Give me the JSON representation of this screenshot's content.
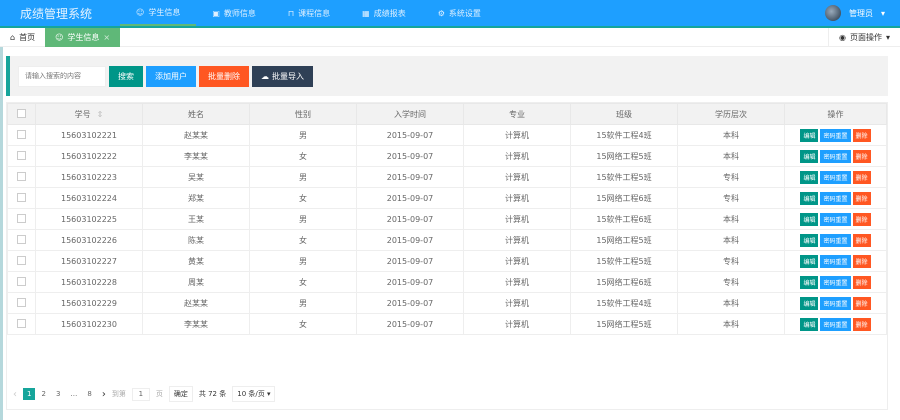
{
  "app": {
    "title": "成绩管理系统"
  },
  "nav": [
    {
      "icon": "users-icon",
      "label": "学生信息"
    },
    {
      "icon": "id-card-icon",
      "label": "教师信息"
    },
    {
      "icon": "book-icon",
      "label": "课程信息"
    },
    {
      "icon": "table-icon",
      "label": "成绩报表"
    },
    {
      "icon": "gear-icon",
      "label": "系统设置"
    }
  ],
  "user": {
    "name": "管理员"
  },
  "tabs": {
    "home": "首页",
    "current": "学生信息",
    "close": "×",
    "page_ops": "页面操作"
  },
  "toolbar": {
    "search_placeholder": "请输入搜索的内容",
    "search": "搜索",
    "add": "添加用户",
    "batch_delete": "批量删除",
    "batch_import": "批量导入"
  },
  "colors": {
    "primary": "#1E9FFF",
    "green": "#009688",
    "red": "#FF5722",
    "dark": "#2F4056"
  },
  "table": {
    "headers": [
      "学号",
      "姓名",
      "性别",
      "入学时间",
      "专业",
      "班级",
      "学历层次",
      "操作"
    ],
    "sort_icon": "⇕",
    "actions": [
      "编辑",
      "密码重置",
      "删除"
    ],
    "rows": [
      [
        "15603102221",
        "赵某某",
        "男",
        "2015-09-07",
        "计算机",
        "15软件工程4班",
        "本科"
      ],
      [
        "15603102222",
        "李某某",
        "女",
        "2015-09-07",
        "计算机",
        "15网络工程5班",
        "本科"
      ],
      [
        "15603102223",
        "吴某",
        "男",
        "2015-09-07",
        "计算机",
        "15软件工程5班",
        "专科"
      ],
      [
        "15603102224",
        "郑某",
        "女",
        "2015-09-07",
        "计算机",
        "15网络工程6班",
        "专科"
      ],
      [
        "15603102225",
        "王某",
        "男",
        "2015-09-07",
        "计算机",
        "15软件工程6班",
        "本科"
      ],
      [
        "15603102226",
        "陈某",
        "女",
        "2015-09-07",
        "计算机",
        "15网络工程5班",
        "本科"
      ],
      [
        "15603102227",
        "黄某",
        "男",
        "2015-09-07",
        "计算机",
        "15软件工程5班",
        "专科"
      ],
      [
        "15603102228",
        "周某",
        "女",
        "2015-09-07",
        "计算机",
        "15网络工程6班",
        "专科"
      ],
      [
        "15603102229",
        "赵某某",
        "男",
        "2015-09-07",
        "计算机",
        "15软件工程4班",
        "本科"
      ],
      [
        "15603102230",
        "李某某",
        "女",
        "2015-09-07",
        "计算机",
        "15网络工程5班",
        "本科"
      ]
    ]
  },
  "pager": {
    "prev": "‹",
    "pages": [
      "1",
      "2",
      "3",
      "…",
      "8"
    ],
    "next": "›",
    "goto": "到第",
    "page_value": "1",
    "page_unit": "页",
    "confirm": "确定",
    "total": "共 72 条",
    "per_page": "10 条/页"
  }
}
